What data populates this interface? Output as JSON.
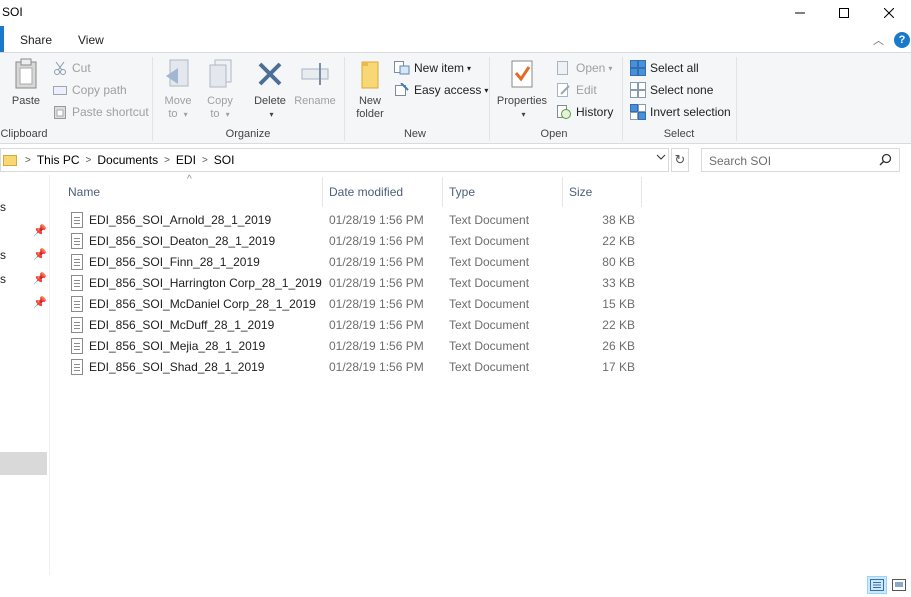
{
  "window": {
    "title": "SOI"
  },
  "ribbon_tabs": {
    "share": "Share",
    "view": "View"
  },
  "ribbon": {
    "clipboard": {
      "label": "Clipboard",
      "paste": "Paste",
      "cut": "Cut",
      "copy_path": "Copy path",
      "paste_shortcut": "Paste shortcut"
    },
    "organize": {
      "label": "Organize",
      "move_to": [
        "Move",
        "to"
      ],
      "copy_to": [
        "Copy",
        "to"
      ],
      "delete": "Delete",
      "rename": "Rename"
    },
    "new": {
      "label": "New",
      "new_folder": [
        "New",
        "folder"
      ],
      "new_item": "New item",
      "easy_access": "Easy access"
    },
    "open": {
      "label": "Open",
      "properties": "Properties",
      "open": "Open",
      "edit": "Edit",
      "history": "History"
    },
    "select": {
      "label": "Select",
      "select_all": "Select all",
      "select_none": "Select none",
      "invert_selection": "Invert selection"
    }
  },
  "address": {
    "breadcrumbs": [
      "This PC",
      "Documents",
      "EDI",
      "SOI"
    ],
    "search_placeholder": "Search SOI"
  },
  "nav_fragments": [
    "s",
    "s",
    "s"
  ],
  "columns": {
    "name": "Name",
    "date": "Date modified",
    "type": "Type",
    "size": "Size"
  },
  "files": [
    {
      "name": "EDI_856_SOI_Arnold_28_1_2019",
      "date": "01/28/19 1:56 PM",
      "type": "Text Document",
      "size": "38 KB"
    },
    {
      "name": "EDI_856_SOI_Deaton_28_1_2019",
      "date": "01/28/19 1:56 PM",
      "type": "Text Document",
      "size": "22 KB"
    },
    {
      "name": "EDI_856_SOI_Finn_28_1_2019",
      "date": "01/28/19 1:56 PM",
      "type": "Text Document",
      "size": "80 KB"
    },
    {
      "name": "EDI_856_SOI_Harrington Corp_28_1_2019",
      "date": "01/28/19 1:56 PM",
      "type": "Text Document",
      "size": "33 KB"
    },
    {
      "name": "EDI_856_SOI_McDaniel Corp_28_1_2019",
      "date": "01/28/19 1:56 PM",
      "type": "Text Document",
      "size": "15 KB"
    },
    {
      "name": "EDI_856_SOI_McDuff_28_1_2019",
      "date": "01/28/19 1:56 PM",
      "type": "Text Document",
      "size": "22 KB"
    },
    {
      "name": "EDI_856_SOI_Mejia_28_1_2019",
      "date": "01/28/19 1:56 PM",
      "type": "Text Document",
      "size": "26 KB"
    },
    {
      "name": "EDI_856_SOI_Shad_28_1_2019",
      "date": "01/28/19 1:56 PM",
      "type": "Text Document",
      "size": "17 KB"
    }
  ],
  "colors": {
    "accent": "#1979ca",
    "folder": "#f8d775",
    "header_text": "#4c607a",
    "selected_view": "#cce8ff"
  }
}
